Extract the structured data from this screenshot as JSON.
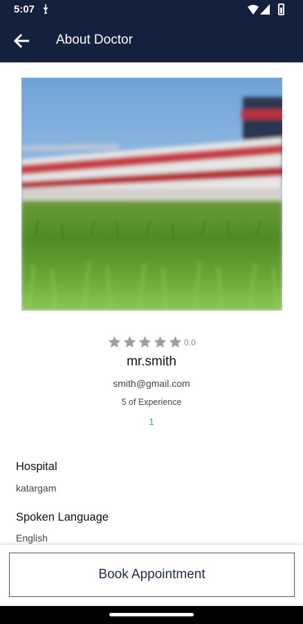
{
  "status_bar": {
    "time": "5:07",
    "icons": [
      "usb-debug-icon",
      "wifi-icon",
      "signal-icon",
      "battery-icon"
    ]
  },
  "app_bar": {
    "back_icon": "arrow-left-icon",
    "title": "About Doctor"
  },
  "doctor": {
    "photo": "stadium-grass-photo",
    "rating_stars": 5,
    "rating_value": "0.0",
    "name": "mr.smith",
    "email": "smith@gmail.com",
    "experience": "5 of Experience",
    "count": "1"
  },
  "details": {
    "hospital_label": "Hospital",
    "hospital_value": "katargam",
    "language_label": "Spoken Language",
    "language_value": "English"
  },
  "actions": {
    "book_label": "Book Appointment"
  },
  "colors": {
    "app_bar": "#13213f",
    "star": "#9e9e9e",
    "link": "#2ba8e0"
  }
}
